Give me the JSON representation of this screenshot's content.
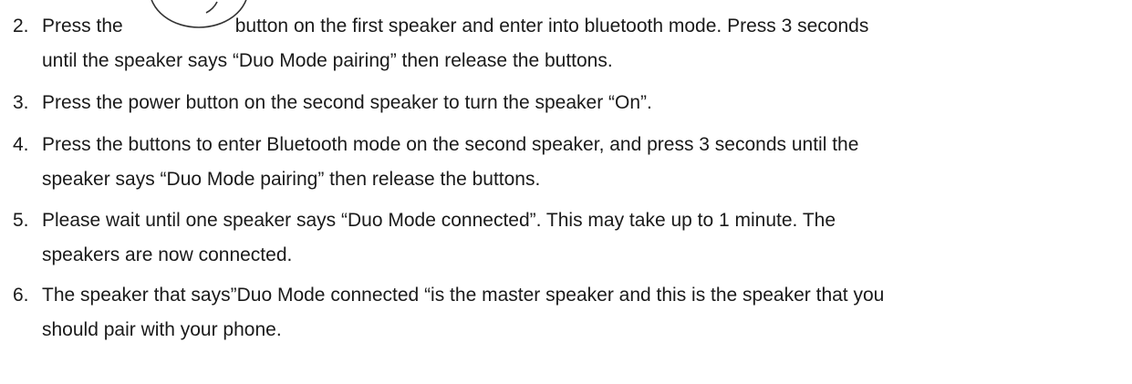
{
  "steps": [
    {
      "num": "2.",
      "before_icon": "Press the",
      "after_icon": "button on the first speaker and enter into bluetooth mode. Press 3 seconds",
      "line2": "until the speaker says “Duo Mode pairing” then release the buttons.",
      "icon": "speaker-button-icon"
    },
    {
      "num": "3.",
      "line1": "Press the power button on the second speaker to turn the speaker “On”."
    },
    {
      "num": "4.",
      "line1": "Press the buttons to enter Bluetooth mode on the second speaker, and press 3 seconds until the",
      "line2": "speaker says “Duo Mode pairing” then release the buttons."
    },
    {
      "num": "5.",
      "line1": "Please wait until one speaker says “Duo Mode connected”. This may take up to 1 minute. The",
      "line2": "speakers are now connected."
    },
    {
      "num": "6.",
      "line1": "The speaker that says”Duo Mode connected “is the master speaker and this is the speaker that you",
      "line2": "should pair with your phone."
    }
  ]
}
